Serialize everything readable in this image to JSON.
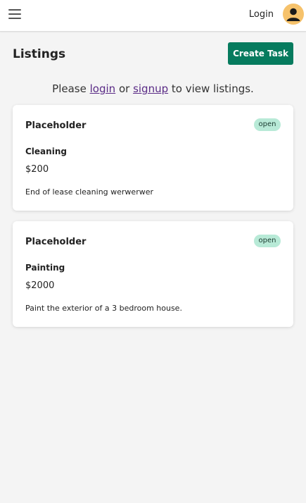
{
  "header": {
    "login_label": "Login"
  },
  "page": {
    "title": "Listings",
    "create_task_label": "Create Task"
  },
  "prompt": {
    "before": "Please ",
    "login_link": "login",
    "middle": " or ",
    "signup_link": "signup",
    "after": " to view listings."
  },
  "listings": [
    {
      "title": "Placeholder",
      "status": "open",
      "category": "Cleaning",
      "price": "$200",
      "description": "End of lease cleaning werwerwer"
    },
    {
      "title": "Placeholder",
      "status": "open",
      "category": "Painting",
      "price": "$2000",
      "description": "Paint the exterior of a 3 bedroom house."
    }
  ],
  "colors": {
    "primary": "#067b5e",
    "badge_bg": "#b8ead7",
    "avatar_bg": "#f6c26b",
    "link": "#5a2b86",
    "background": "#f4f4f4"
  },
  "icons": {
    "menu": "hamburger-menu-icon",
    "avatar": "user-avatar-icon"
  }
}
